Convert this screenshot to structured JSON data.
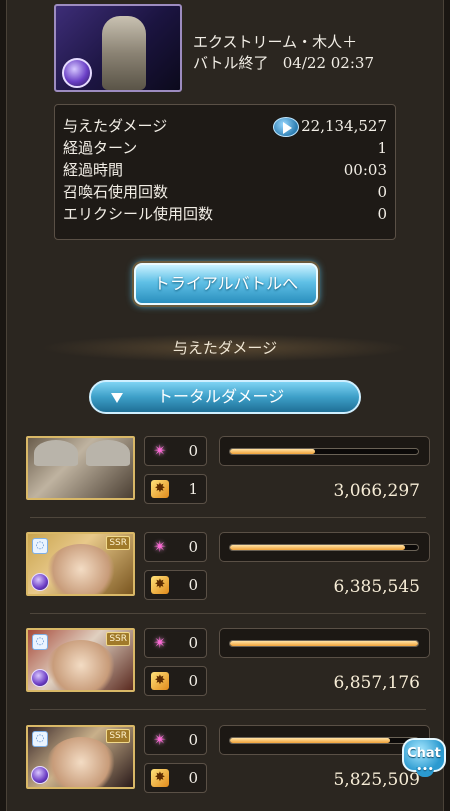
{
  "quest": {
    "name": "エクストリーム・木人＋",
    "status": "バトル終了",
    "datetime": "04/22 02:37",
    "thumbnail_icon": "quest-banner-icon"
  },
  "stats": [
    {
      "label": "与えたダメージ",
      "value": "22,134,527",
      "has_play": true
    },
    {
      "label": "経過ターン",
      "value": "1"
    },
    {
      "label": "経過時間",
      "value": "00:03"
    },
    {
      "label": "召喚石使用回数",
      "value": "0"
    },
    {
      "label": "エリクシール使用回数",
      "value": "0"
    }
  ],
  "trial_button": {
    "label": "トライアルバトルへ"
  },
  "section": {
    "label": "与えたダメージ"
  },
  "dropdown": {
    "label": "トータルダメージ",
    "icon": "triangle-down-icon"
  },
  "characters": [
    {
      "name": "main-character",
      "ssr": false,
      "element_icon": false,
      "ability_count": "0",
      "ougi_count": "1",
      "damage": "3,066,297",
      "bar_fraction": 0.45
    },
    {
      "name": "character-2",
      "ssr": true,
      "ssr_label": "SSR",
      "element_icon": true,
      "ability_count": "0",
      "ougi_count": "0",
      "damage": "6,385,545",
      "bar_fraction": 0.93
    },
    {
      "name": "character-3",
      "ssr": true,
      "ssr_label": "SSR",
      "element_icon": true,
      "ability_count": "0",
      "ougi_count": "0",
      "damage": "6,857,176",
      "bar_fraction": 1.0
    },
    {
      "name": "character-4",
      "ssr": true,
      "ssr_label": "SSR",
      "element_icon": true,
      "ability_count": "0",
      "ougi_count": "0",
      "damage": "5,825,509",
      "bar_fraction": 0.85
    }
  ],
  "icons": {
    "ability": "sparkle-icon",
    "ougi": "burst-icon",
    "element": "ring-icon",
    "class": "orb-icon"
  },
  "chat": {
    "label": "Chat",
    "dots": "•••"
  },
  "colors": {
    "bar_fill": "#f0a33a",
    "accent_blue": "#3d9fc8",
    "panel": "#2b2620"
  }
}
